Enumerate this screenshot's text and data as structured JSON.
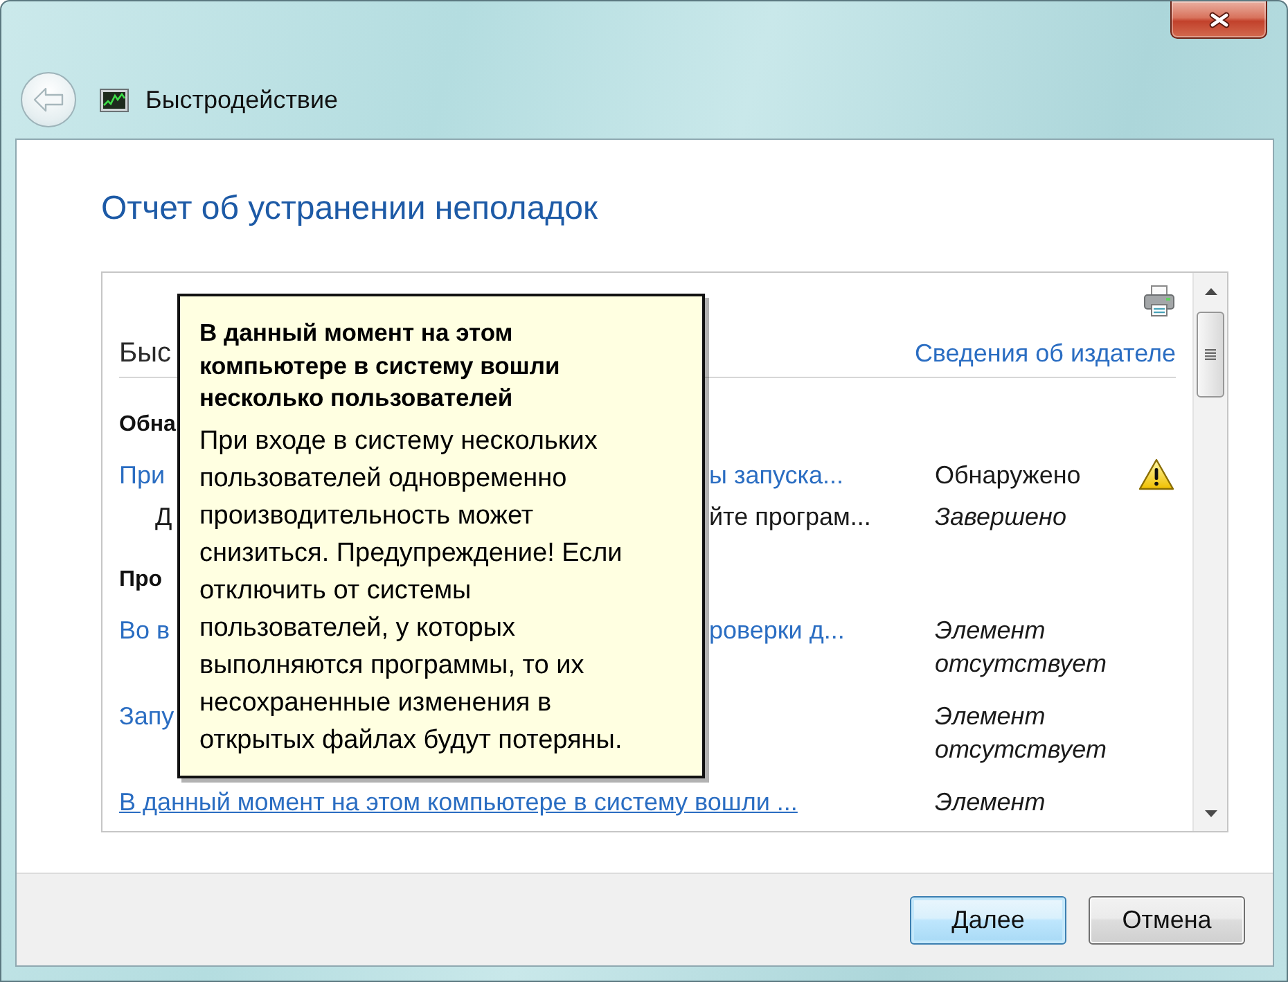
{
  "window": {
    "title": "Быстродействие"
  },
  "heading": "Отчет об устранении неполадок",
  "report": {
    "title": "Быс",
    "publisher_link": "Сведения об издателе",
    "sections": [
      {
        "header": "Обна",
        "rows": [
          {
            "text_start": "При",
            "text_end": "ы запуска...",
            "hovered": false,
            "status": "Обнаружено",
            "found": true,
            "children": [
              {
                "text_start": "Д",
                "text_end": "йте програм...",
                "status": "Завершено",
                "found": false
              }
            ]
          }
        ]
      },
      {
        "header": "Про",
        "rows": [
          {
            "text_start": "Во в",
            "text_end": "роверки д...",
            "hovered": false,
            "status": "Элемент отсутствует",
            "found": false
          },
          {
            "text_start": "Запу",
            "hovered": false,
            "status": "Элемент отсутствует",
            "found": false
          },
          {
            "text": "В данный момент на этом компьютере в систему вошли ...",
            "hovered": true,
            "status": "Элемент",
            "found": false
          }
        ]
      }
    ]
  },
  "tooltip": {
    "title": "В данный момент на этом компьютере в систему вошли несколько пользователей",
    "text": "При входе в систему нескольких пользователей одновременно производительность может снизиться. Предупреждение! Если отключить от системы пользователей, у которых выполняются программы, то их несохраненные изменения в открытых файлах будут потеряны."
  },
  "buttons": [
    {
      "label": "Далее",
      "default": true
    },
    {
      "label": "Отмена",
      "default": false
    }
  ]
}
